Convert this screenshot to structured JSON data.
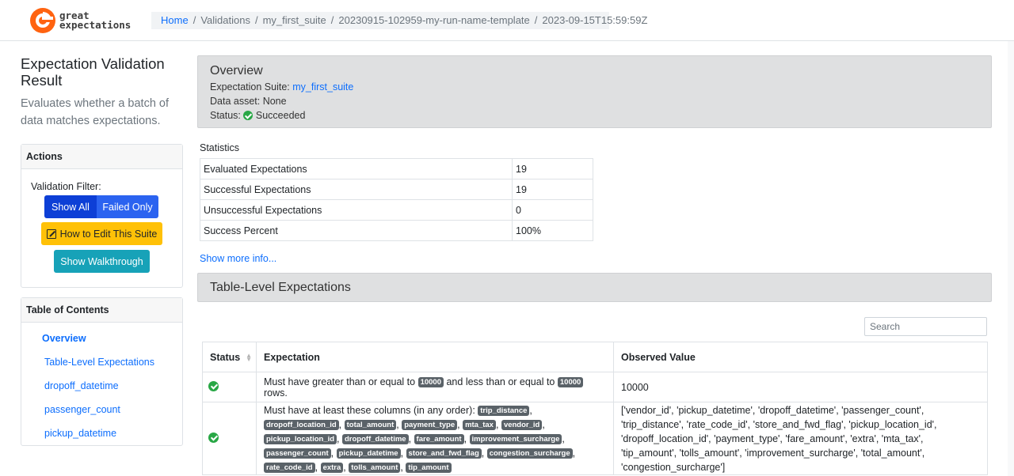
{
  "header": {
    "logo_line1": "great",
    "logo_line2": "expectations",
    "breadcrumb": {
      "home": "Home",
      "path": [
        "Validations",
        "my_first_suite",
        "20230915-102959-my-run-name-template",
        "2023-09-15T15:59:59Z"
      ]
    }
  },
  "sidebar": {
    "title": "Expectation Validation Result",
    "description": "Evaluates whether a batch of data matches expectations.",
    "actions": {
      "header": "Actions",
      "filter_label": "Validation Filter:",
      "show_all": "Show All",
      "failed_only": "Failed Only",
      "edit_suite": "How to Edit This Suite",
      "walkthrough": "Show Walkthrough"
    },
    "toc": {
      "header": "Table of Contents",
      "items": [
        "Overview",
        "Table-Level Expectations",
        "dropoff_datetime",
        "passenger_count",
        "pickup_datetime"
      ]
    }
  },
  "overview": {
    "title": "Overview",
    "suite_label": "Expectation Suite:",
    "suite_name": "my_first_suite",
    "data_asset": "Data asset: None",
    "status_label": "Status:",
    "status_value": "Succeeded",
    "status_color": "#28a745"
  },
  "statistics": {
    "title": "Statistics",
    "rows": [
      {
        "k": "Evaluated Expectations",
        "v": "19"
      },
      {
        "k": "Successful Expectations",
        "v": "19"
      },
      {
        "k": "Unsuccessful Expectations",
        "v": "0"
      },
      {
        "k": "Success Percent",
        "v": "100%"
      }
    ],
    "show_more": "Show more info..."
  },
  "table_level": {
    "title": "Table-Level Expectations",
    "search_placeholder": "Search",
    "columns": [
      "Status",
      "Expectation",
      "Observed Value"
    ],
    "row1": {
      "pre": "Must have greater than or equal to",
      "min": "10000",
      "mid": "and less than or equal to",
      "max": "10000",
      "post": "rows.",
      "observed": "10000"
    },
    "row2": {
      "pre": "Must have at least these columns (in any order):",
      "columns": [
        "trip_distance",
        "dropoff_location_id",
        "total_amount",
        "payment_type",
        "mta_tax",
        "vendor_id",
        "pickup_location_id",
        "dropoff_datetime",
        "fare_amount",
        "improvement_surcharge",
        "passenger_count",
        "pickup_datetime",
        "store_and_fwd_flag",
        "congestion_surcharge",
        "rate_code_id",
        "extra",
        "tolls_amount",
        "tip_amount"
      ],
      "observed": "['vendor_id', 'pickup_datetime', 'dropoff_datetime', 'passenger_count', 'trip_distance', 'rate_code_id', 'store_and_fwd_flag', 'pickup_location_id', 'dropoff_location_id', 'payment_type', 'fare_amount', 'extra', 'mta_tax', 'tip_amount', 'tolls_amount', 'improvement_surcharge', 'total_amount', 'congestion_surcharge']"
    }
  }
}
